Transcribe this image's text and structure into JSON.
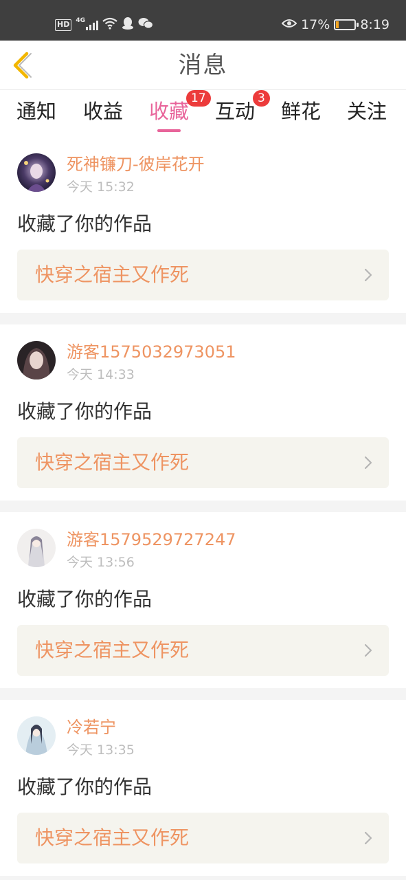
{
  "status_bar": {
    "hd": "HD",
    "net": "4G",
    "battery": "17%",
    "battery_level": 0.17,
    "time": "8:19",
    "icons": [
      "signal-icon",
      "wifi-icon",
      "qq-icon",
      "wechat-icon",
      "eye-icon",
      "battery-icon"
    ]
  },
  "header": {
    "title": "消息",
    "back_icon": "back-chevron-icon"
  },
  "tabs": [
    {
      "label": "通知",
      "badge": ""
    },
    {
      "label": "收益",
      "badge": ""
    },
    {
      "label": "收藏",
      "badge": "17",
      "active": true
    },
    {
      "label": "互动",
      "badge": "3"
    },
    {
      "label": "鲜花",
      "badge": ""
    },
    {
      "label": "关注",
      "badge": ""
    }
  ],
  "colors": {
    "accent": "#e8649a",
    "name": "#ee9462",
    "badge": "#ec3b3b",
    "box": "#f5f4ee"
  },
  "items": [
    {
      "user": "死神镰刀-彼岸花开",
      "time": "今天 15:32",
      "action": "收藏了你的作品",
      "work": "快穿之宿主又作死"
    },
    {
      "user": "游客1575032973051",
      "time": "今天 14:33",
      "action": "收藏了你的作品",
      "work": "快穿之宿主又作死"
    },
    {
      "user": "游客1579529727247",
      "time": "今天 13:56",
      "action": "收藏了你的作品",
      "work": "快穿之宿主又作死"
    },
    {
      "user": "冷若宁",
      "time": "今天 13:35",
      "action": "收藏了你的作品",
      "work": "快穿之宿主又作死"
    }
  ]
}
